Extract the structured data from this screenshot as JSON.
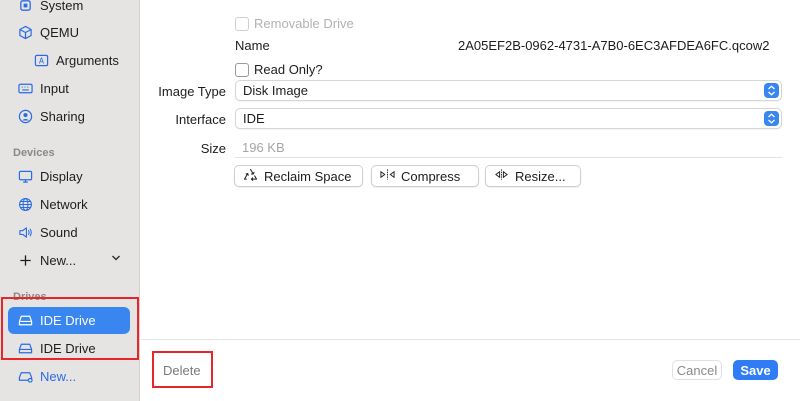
{
  "sidebar": {
    "top_items": [
      {
        "label": "System",
        "icon": "cpu-icon"
      },
      {
        "label": "QEMU",
        "icon": "cube-icon"
      },
      {
        "label": "Arguments",
        "icon": "text-field-icon"
      },
      {
        "label": "Input",
        "icon": "keyboard-icon"
      },
      {
        "label": "Sharing",
        "icon": "person-circle-icon"
      }
    ],
    "devices_heading": "Devices",
    "device_items": [
      {
        "label": "Display",
        "icon": "display-icon"
      },
      {
        "label": "Network",
        "icon": "globe-icon"
      },
      {
        "label": "Sound",
        "icon": "speaker-icon"
      }
    ],
    "devices_new": "New...",
    "drives_heading": "Drives",
    "drive_items": [
      {
        "label": "IDE Drive",
        "icon": "drive-icon"
      },
      {
        "label": "IDE Drive",
        "icon": "drive-icon"
      }
    ],
    "drives_new": "New..."
  },
  "form": {
    "removable_label": "Removable Drive",
    "name_label": "Name",
    "name_value": "2A05EF2B-0962-4731-A7B0-6EC3AFDEA6FC.qcow2",
    "read_only_label": "Read Only?",
    "image_type_label": "Image Type",
    "image_type_value": "Disk Image",
    "interface_label": "Interface",
    "interface_value": "IDE",
    "size_label": "Size",
    "size_placeholder": "196 KB"
  },
  "actions": {
    "reclaim": "Reclaim Space",
    "compress": "Compress",
    "resize": "Resize..."
  },
  "footer": {
    "delete": "Delete",
    "cancel": "Cancel",
    "save": "Save"
  },
  "colors": {
    "accent": "#3a86f1",
    "highlight_box": "#e8262a"
  }
}
